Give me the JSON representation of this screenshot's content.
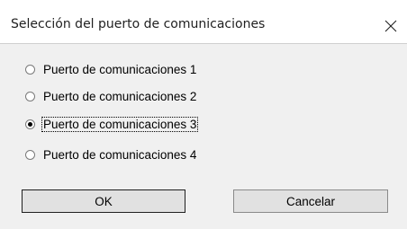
{
  "dialog": {
    "title": "Selección del puerto de comunicaciones",
    "close_icon": "close-icon"
  },
  "options": [
    {
      "label": "Puerto de comunicaciones 1",
      "checked": false
    },
    {
      "label": "Puerto de comunicaciones 2",
      "checked": false
    },
    {
      "label": "Puerto de comunicaciones 3",
      "checked": true
    },
    {
      "label": "Puerto de comunicaciones 4",
      "checked": false
    }
  ],
  "buttons": {
    "ok_label": "OK",
    "cancel_label": "Cancelar"
  }
}
